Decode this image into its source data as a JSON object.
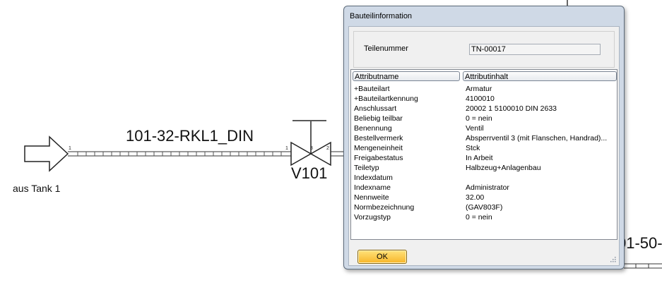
{
  "drawing": {
    "line_label": "101-32-RKL1_DIN",
    "valve_label": "V101",
    "tank_label": "aus Tank 1",
    "right_label": "01-50-",
    "pins": [
      "1",
      "1",
      "3",
      "2"
    ]
  },
  "dialog": {
    "title": "Bauteilinformation",
    "part_number_label": "Teilenummer",
    "part_number_value": "TN-00017",
    "columns": [
      "Attributname",
      "Attributinhalt"
    ],
    "rows": [
      {
        "name": "+Bauteilart",
        "value": "Armatur"
      },
      {
        "name": "+Bauteilartkennung",
        "value": "4100010"
      },
      {
        "name": "Anschlussart",
        "value": "20002 1 5100010 DIN 2633"
      },
      {
        "name": "Beliebig teilbar",
        "value": "0 = nein"
      },
      {
        "name": "Benennung",
        "value": "Ventil"
      },
      {
        "name": "Bestellvermerk",
        "value": "Absperrventil 3 (mit Flanschen, Handrad)..."
      },
      {
        "name": "Mengeneinheit",
        "value": "Stck"
      },
      {
        "name": "Freigabestatus",
        "value": "In Arbeit"
      },
      {
        "name": "Teiletyp",
        "value": "Halbzeug+Anlagenbau"
      },
      {
        "name": "Indexdatum",
        "value": ""
      },
      {
        "name": "Indexname",
        "value": "Administrator"
      },
      {
        "name": "Nennweite",
        "value": "32.00"
      },
      {
        "name": "Normbezeichnung",
        "value": "(GAV803F)"
      },
      {
        "name": "Vorzugstyp",
        "value": "0 = nein"
      }
    ],
    "ok_label": "OK"
  }
}
